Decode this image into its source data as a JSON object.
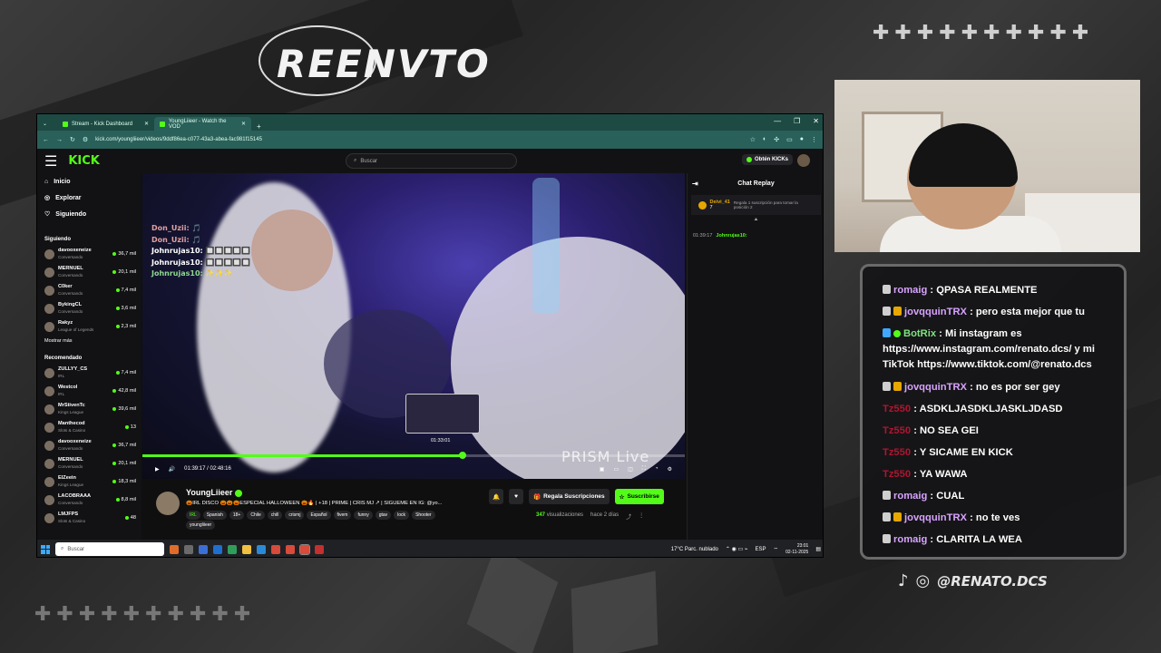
{
  "overlay": {
    "logo_text": "REENVTO",
    "social_handle": "@RENATO.DCS",
    "tiktok_icon": "tiktok-icon",
    "instagram_icon": "instagram-icon"
  },
  "browser": {
    "tabs": [
      {
        "label": "Stream - Kick Dashboard"
      },
      {
        "label": "YoungLiieer - Watch the VOD"
      }
    ],
    "url": "kick.com/youngliieer/videos/9ddf86ea-c077-43a3-abea-fac981f15145"
  },
  "kick": {
    "logo": "KICK",
    "search_placeholder": "Buscar",
    "get_kicks": "Obtén KICKs",
    "nav": [
      "Inicio",
      "Explorar",
      "Siguiendo"
    ],
    "following_title": "Siguiendo",
    "following": [
      {
        "name": "davooxeneize",
        "category": "Conversando",
        "viewers": "36,7 mil"
      },
      {
        "name": "MERNUEL",
        "category": "Conversando",
        "viewers": "20,1 mil"
      },
      {
        "name": "C0ker",
        "category": "Conversando",
        "viewers": "7,4 mil"
      },
      {
        "name": "BykingCL",
        "category": "Conversando",
        "viewers": "3,6 mil"
      },
      {
        "name": "Rakyz",
        "category": "League of Legends",
        "viewers": "2,3 mil"
      }
    ],
    "show_more": "Mostrar más",
    "recommended_title": "Recomendado",
    "recommended": [
      {
        "name": "ZULLYY_CS",
        "category": "IRL",
        "viewers": "7,4 mil"
      },
      {
        "name": "Westcol",
        "category": "IRL",
        "viewers": "42,8 mil"
      },
      {
        "name": "MrStivenTc",
        "category": "Kings League",
        "viewers": "39,6 mil"
      },
      {
        "name": "Manthecod",
        "category": "Slots & Casino",
        "viewers": "13"
      },
      {
        "name": "davooxeneize",
        "category": "Conversando",
        "viewers": "36,7 mil"
      },
      {
        "name": "MERNUEL",
        "category": "Conversando",
        "viewers": "20,1 mil"
      },
      {
        "name": "ElZeein",
        "category": "Kings League",
        "viewers": "18,3 mil"
      },
      {
        "name": "LACOBRAAA",
        "category": "Conversando",
        "viewers": "8,8 mil"
      },
      {
        "name": "LMJFPS",
        "category": "Slots & Casino",
        "viewers": "48"
      }
    ],
    "video": {
      "overlay_lines": [
        {
          "text": "Don_Uzii: 🎵",
          "color": "#e0a0a0"
        },
        {
          "text": "Don_Uzii: 🎵",
          "color": "#e0a0a0"
        },
        {
          "text": "Johnrujas10: 🔲🔲🔲🔲🔲",
          "color": "#ffffff"
        },
        {
          "text": "Johnrujas10: 🔲🔲🔲🔲🔲",
          "color": "#ffffff"
        },
        {
          "text": "Johnrujas10: ✨✨✨",
          "color": "#8fd88f"
        }
      ],
      "thumb_time": "01:33:01",
      "current_time": "01:39:17",
      "duration": "02:48:16",
      "progress": 0.59,
      "watermark": "PRISM Live"
    },
    "chat": {
      "title": "Chat Replay",
      "pinned_user": "Deivi_41",
      "pinned_count": "7",
      "pinned_text": "Regala 1 suscripción para tomar la posición 2",
      "message_time": "01:39:17",
      "message_user": "Johnrujas10:"
    },
    "streamer": {
      "name": "YoungLiieer",
      "title": "🎃IRL DISCO 🎃🎃🎃ESPECIAL HALLOWEEN 🎃🔥 | +18 | PRIME | CRIS MJ ↗ | SIGUEME EN IG: @yo...",
      "category": "IRL",
      "tags": [
        "Spanish",
        "18+",
        "Chile",
        "chill",
        "crismj",
        "Español",
        "fivem",
        "funny",
        "gtav",
        "lock",
        "Shooter"
      ],
      "tag_extra": "youngliieer",
      "gift_subs": "Regala Suscripciones",
      "subscribe": "Suscribirse",
      "views_count": "347",
      "views_label": "visualizaciones",
      "ago": "hace 2 días"
    }
  },
  "taskbar": {
    "search": "Buscar",
    "weather": "17°C  Parc. nublado",
    "lang": "ESP",
    "time": "23:01",
    "date": "02-11-2025"
  },
  "overlay_chat": [
    {
      "badges": [
        "pass"
      ],
      "user": "romaig",
      "user_color": "#d8a3ff",
      "text": ": QPASA REALMENTE"
    },
    {
      "badges": [
        "pass",
        "crown"
      ],
      "user": "jovqquinTRX",
      "user_color": "#d8a3ff",
      "text": ": pero esta mejor que tu"
    },
    {
      "badges": [
        "kick",
        "bot"
      ],
      "user": "BotRix",
      "user_color": "#7fe27f",
      "text": ": Mi instagram es https://www.instagram.com/renato.dcs/ y mi TikTok https://www.tiktok.com/@renato.dcs"
    },
    {
      "badges": [
        "pass",
        "crown"
      ],
      "user": "jovqquinTRX",
      "user_color": "#d8a3ff",
      "text": ": no es por ser gey"
    },
    {
      "badges": [],
      "user": "Tz550",
      "user_color": "#b01530",
      "text": ": ASDKLJASDKLJASKLJDASD"
    },
    {
      "badges": [],
      "user": "Tz550",
      "user_color": "#b01530",
      "text": ": NO SEA GEI"
    },
    {
      "badges": [],
      "user": "Tz550",
      "user_color": "#b01530",
      "text": ": Y SICAME EN KICK"
    },
    {
      "badges": [],
      "user": "Tz550",
      "user_color": "#b01530",
      "text": ": YA WAWA"
    },
    {
      "badges": [
        "pass"
      ],
      "user": "romaig",
      "user_color": "#d8a3ff",
      "text": ": CUAL"
    },
    {
      "badges": [
        "pass",
        "crown"
      ],
      "user": "jovqquinTRX",
      "user_color": "#d8a3ff",
      "text": ": no te ves"
    },
    {
      "badges": [
        "pass"
      ],
      "user": "romaig",
      "user_color": "#d8a3ff",
      "text": ": CLARITA LA WEA"
    }
  ]
}
